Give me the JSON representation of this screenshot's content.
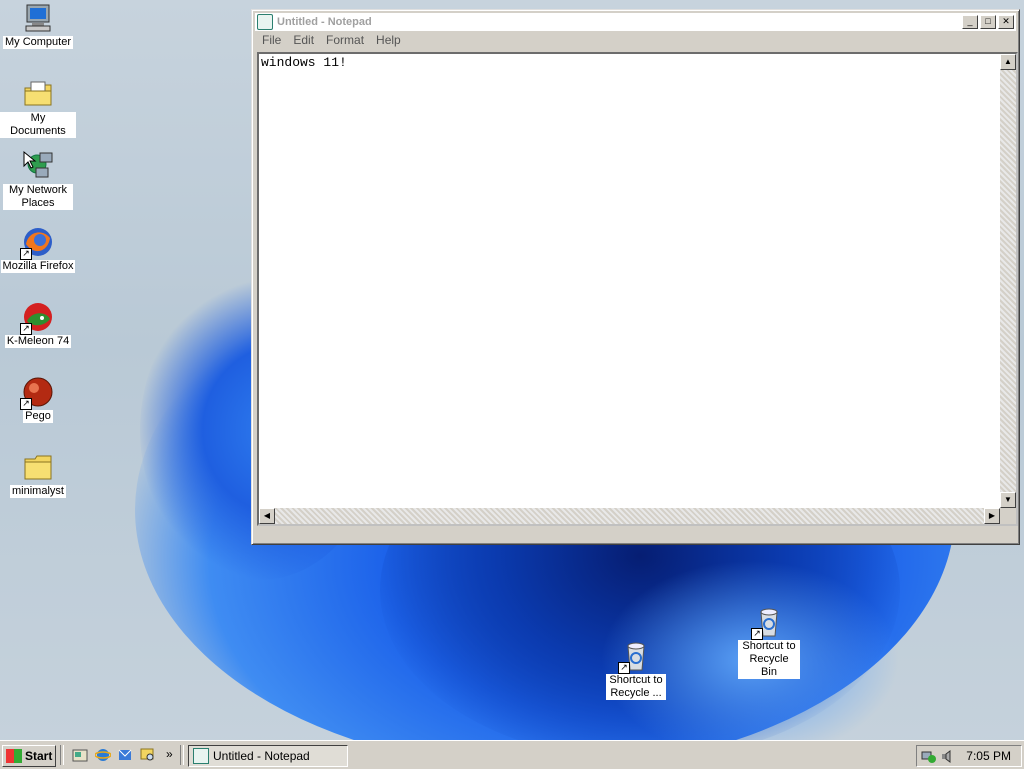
{
  "desktop": {
    "icons": [
      {
        "label": "My Computer",
        "icon": "computer-icon"
      },
      {
        "label": "My Documents",
        "icon": "documents-folder-icon"
      },
      {
        "label": "My Network Places",
        "icon": "network-places-icon"
      },
      {
        "label": "Mozilla Firefox",
        "icon": "firefox-icon"
      },
      {
        "label": "K-Meleon 74",
        "icon": "k-meleon-icon"
      },
      {
        "label": "Pego",
        "icon": "pego-icon"
      },
      {
        "label": "minimalyst",
        "icon": "folder-icon"
      },
      {
        "label": "Shortcut to Recycle ...",
        "icon": "recycle-bin-icon"
      },
      {
        "label": "Shortcut to Recycle Bin",
        "icon": "recycle-bin-icon"
      }
    ]
  },
  "notepad": {
    "title": "Untitled - Notepad",
    "menu": [
      "File",
      "Edit",
      "Format",
      "Help"
    ],
    "content": "windows 11!"
  },
  "taskbar": {
    "start_label": "Start",
    "task_label": "Untitled - Notepad",
    "clock": "7:05 PM",
    "quicklaunch_more": "»"
  },
  "colors": {
    "chrome": "#d4d0c8",
    "wallpaper_blue": "#1d63ea"
  }
}
